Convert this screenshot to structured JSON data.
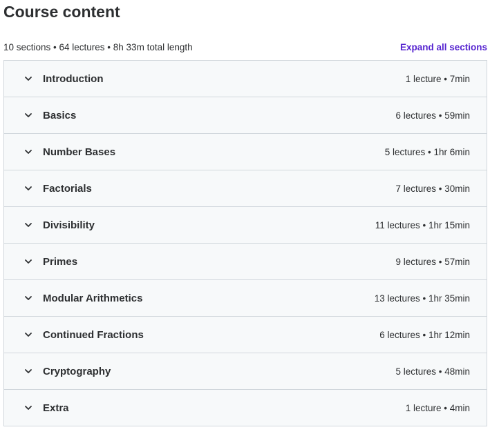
{
  "header": {
    "title": "Course content"
  },
  "summary": {
    "text": "10 sections • 64 lectures • 8h 33m total length",
    "expand_label": "Expand all sections"
  },
  "sections": [
    {
      "title": "Introduction",
      "meta": "1 lecture • 7min"
    },
    {
      "title": "Basics",
      "meta": "6 lectures • 59min"
    },
    {
      "title": "Number Bases",
      "meta": "5 lectures • 1hr 6min"
    },
    {
      "title": "Factorials",
      "meta": "7 lectures • 30min"
    },
    {
      "title": "Divisibility",
      "meta": "11 lectures • 1hr 15min"
    },
    {
      "title": "Primes",
      "meta": "9 lectures • 57min"
    },
    {
      "title": "Modular Arithmetics",
      "meta": "13 lectures • 1hr 35min"
    },
    {
      "title": "Continued Fractions",
      "meta": "6 lectures • 1hr 12min"
    },
    {
      "title": "Cryptography",
      "meta": "5 lectures • 48min"
    },
    {
      "title": "Extra",
      "meta": "1 lecture • 4min"
    }
  ],
  "icons": {
    "section_toggle": "chevron-down-icon"
  },
  "colors": {
    "text": "#2d2f31",
    "link": "#5624d0",
    "panel_bg": "#f7f9fa",
    "border": "#d1d7dc"
  }
}
